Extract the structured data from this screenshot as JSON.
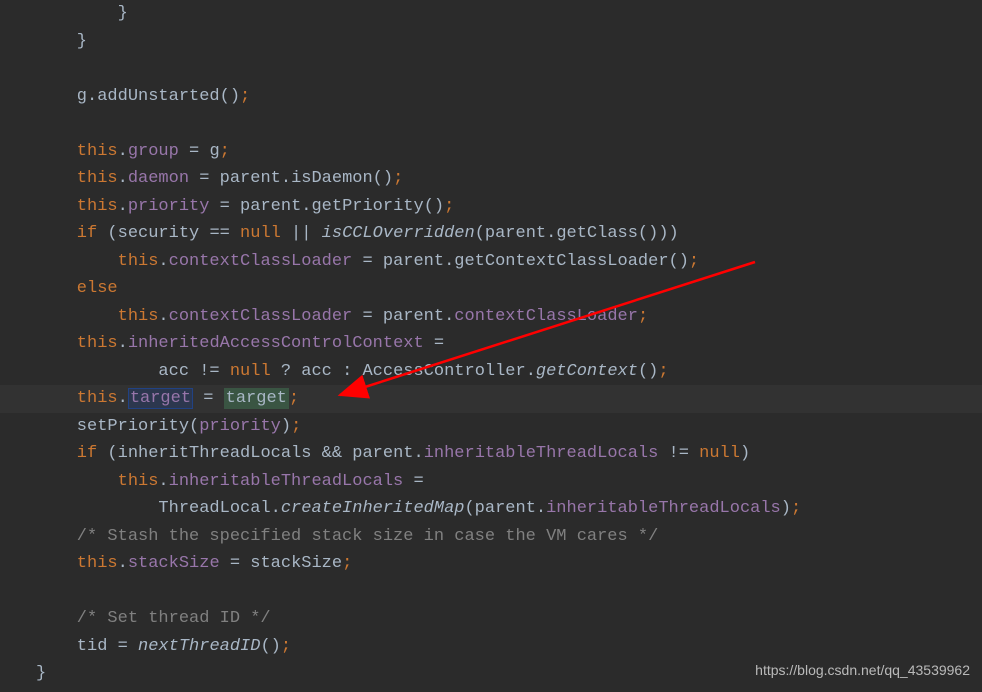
{
  "code": {
    "l1": "        }",
    "l2": "    }",
    "l3": "",
    "l4_pre": "    g.addUnstarted()",
    "l4_semi": ";",
    "l5": "",
    "l6_this": "    this",
    "l6_dot": ".",
    "l6_prop": "group",
    "l6_eq": " = g",
    "l6_semi": ";",
    "l7_this": "    this",
    "l7_dot": ".",
    "l7_prop": "daemon",
    "l7_eq": " = parent.isDaemon()",
    "l7_semi": ";",
    "l8_this": "    this",
    "l8_dot": ".",
    "l8_prop": "priority",
    "l8_eq": " = parent.getPriority()",
    "l8_semi": ";",
    "l9_if": "    if ",
    "l9_par": "(security == ",
    "l9_null": "null",
    "l9_or": " || ",
    "l9_method": "isCCLOverridden",
    "l9_call": "(parent.getClass()))",
    "l10_this": "        this",
    "l10_dot": ".",
    "l10_prop": "contextClassLoader",
    "l10_eq": " = parent.getContextClassLoader()",
    "l10_semi": ";",
    "l11_else": "    else",
    "l12_this": "        this",
    "l12_dot": ".",
    "l12_prop": "contextClassLoader",
    "l12_eq": " = parent.",
    "l12_prop2": "contextClassLoader",
    "l12_semi": ";",
    "l13_this": "    this",
    "l13_dot": ".",
    "l13_prop": "inheritedAccessControlContext",
    "l13_eq": " =",
    "l14_pre": "            acc != ",
    "l14_null": "null",
    "l14_q": " ? acc : AccessController.",
    "l14_method": "getContext",
    "l14_call": "()",
    "l14_semi": ";",
    "l15_this": "    this",
    "l15_dot": ".",
    "l15_target1": "target",
    "l15_eq": " = ",
    "l15_target2": "target",
    "l15_semi": ";",
    "l16_pre": "    setPriority(",
    "l16_prop": "priority",
    "l16_close": ")",
    "l16_semi": ";",
    "l17_if": "    if ",
    "l17_par": "(inheritThreadLocals && parent.",
    "l17_prop": "inheritableThreadLocals",
    "l17_ne": " != ",
    "l17_null": "null",
    "l17_close": ")",
    "l18_this": "        this",
    "l18_dot": ".",
    "l18_prop": "inheritableThreadLocals",
    "l18_eq": " =",
    "l19_pre": "            ThreadLocal.",
    "l19_method": "createInheritedMap",
    "l19_mid": "(parent.",
    "l19_prop": "inheritableThreadLocals",
    "l19_close": ")",
    "l19_semi": ";",
    "l20": "    /* Stash the specified stack size in case the VM cares */",
    "l21_this": "    this",
    "l21_dot": ".",
    "l21_prop": "stackSize",
    "l21_eq": " = stackSize",
    "l21_semi": ";",
    "l22": "",
    "l23": "    /* Set thread ID */",
    "l24_pre": "    tid = ",
    "l24_method": "nextThreadID",
    "l24_call": "()",
    "l24_semi": ";",
    "l25": "}"
  },
  "watermark": "https://blog.csdn.net/qq_43539962"
}
